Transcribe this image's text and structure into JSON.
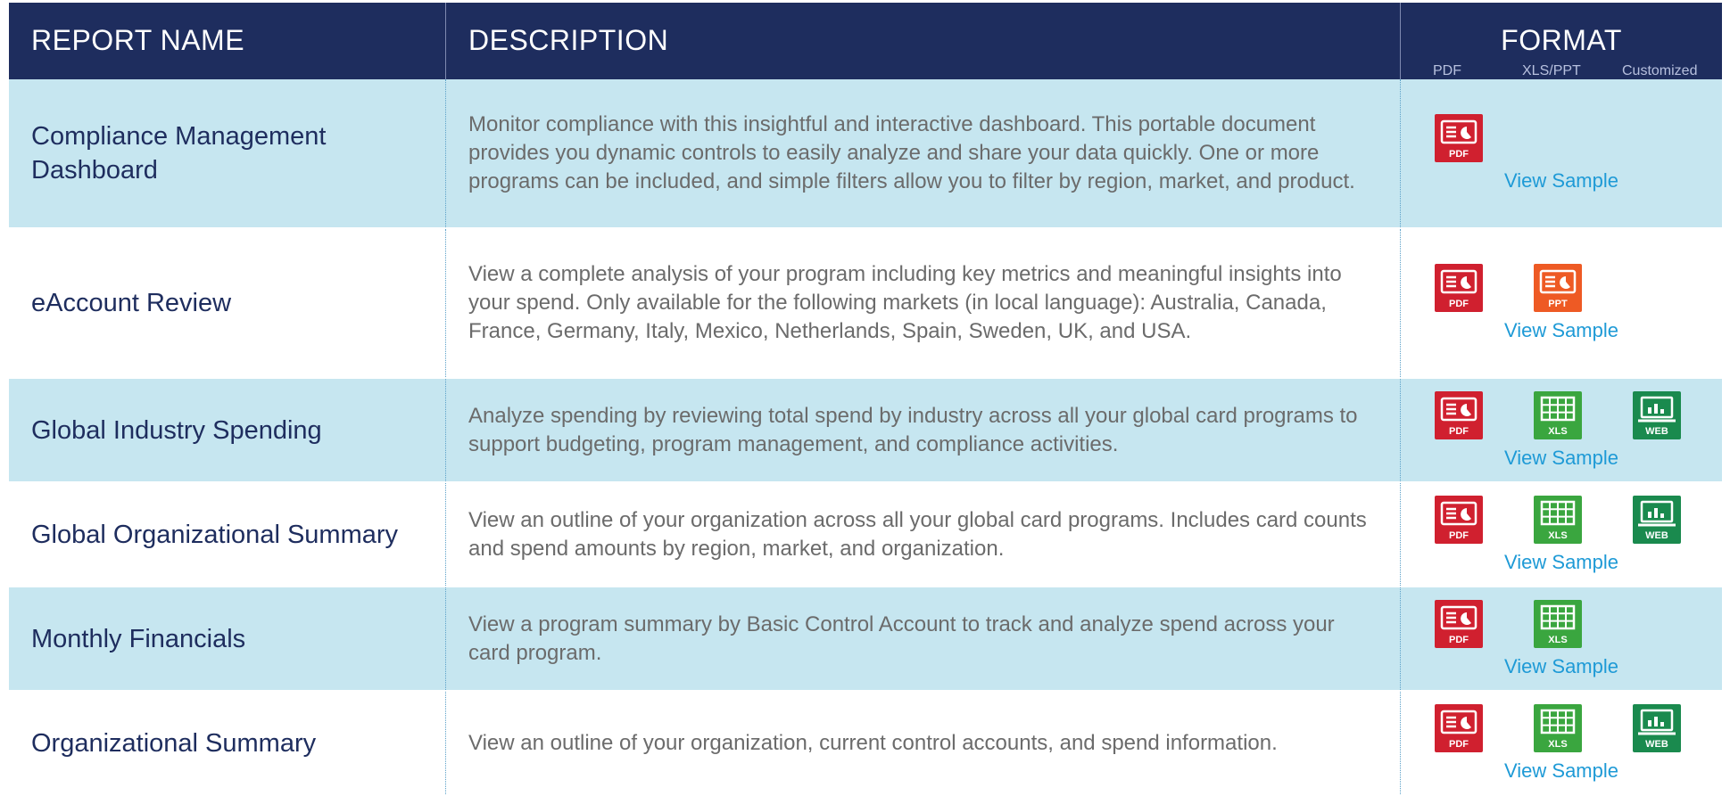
{
  "colors": {
    "header_bg": "#1e2d5e",
    "row_shade": "#c6e6f0",
    "pdf": "#d0202f",
    "ppt": "#ee5a24",
    "xls": "#3aa63f",
    "web": "#1a8a4e",
    "link": "#1e9ad6"
  },
  "header": {
    "report_name": "REPORT NAME",
    "description": "DESCRIPTION",
    "format": "FORMAT",
    "sub_pdf": "PDF",
    "sub_xls_ppt": "XLS/PPT",
    "sub_customized": "Customized"
  },
  "icon_labels": {
    "pdf": "PDF",
    "ppt": "PPT",
    "xls": "XLS",
    "web": "WEB"
  },
  "rows": [
    {
      "name": "Compliance Management Dashboard",
      "description": "Monitor compliance with this insightful and interactive dashboard. This portable document provides you dynamic controls to easily analyze and share your data quickly. One or more programs can be included, and simple filters allow you to filter by region, market, and product.",
      "formats": [
        "pdf"
      ],
      "link": "View Sample"
    },
    {
      "name": "eAccount Review",
      "description": "View a complete analysis of your program including key metrics and meaningful insights into your spend. Only available for the following markets (in local language): Australia, Canada, France, Germany, Italy, Mexico, Netherlands, Spain, Sweden, UK, and USA.",
      "formats": [
        "pdf",
        "ppt"
      ],
      "link": "View Sample"
    },
    {
      "name": "Global Industry Spending",
      "description": "Analyze spending by reviewing total spend by industry across all your global card programs to support budgeting, program management, and compliance activities.",
      "formats": [
        "pdf",
        "xls",
        "web"
      ],
      "link": "View Sample"
    },
    {
      "name": "Global Organizational Summary",
      "description": "View an outline of your organization across all your global card programs. Includes card counts and spend amounts by region, market, and organization.",
      "formats": [
        "pdf",
        "xls",
        "web"
      ],
      "link": "View Sample"
    },
    {
      "name": "Monthly Financials",
      "description": "View a program summary by Basic Control Account to track and analyze spend across your card program.",
      "formats": [
        "pdf",
        "xls"
      ],
      "link": "View Sample"
    },
    {
      "name": "Organizational Summary",
      "description": "View an outline of your organization, current control accounts, and spend information.",
      "formats": [
        "pdf",
        "xls",
        "web"
      ],
      "link": "View Sample"
    }
  ]
}
